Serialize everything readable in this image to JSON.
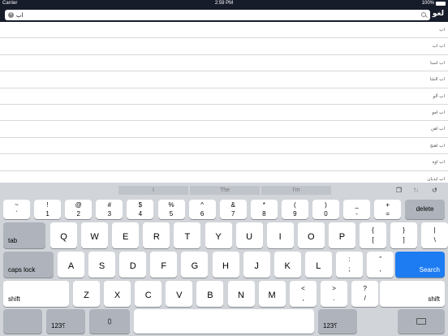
{
  "status_bar": {
    "carrier": "Carrier",
    "time": "2:59 PM",
    "battery": "100%"
  },
  "nav": {
    "title": "لغو",
    "search_value": "اب"
  },
  "results": [
    "اب",
    "اب اب",
    "اب اسبا",
    "اب الشا",
    "اب آلو",
    "اب امو",
    "اب اهن",
    "اب اهنج",
    "اب اوه",
    "اب ایدیان"
  ],
  "keyboard": {
    "predictions": [
      "I",
      "The",
      "I'm"
    ],
    "number_row": [
      {
        "top": "~",
        "bottom": "`"
      },
      {
        "top": "!",
        "bottom": "1"
      },
      {
        "top": "@",
        "bottom": "2"
      },
      {
        "top": "#",
        "bottom": "3"
      },
      {
        "top": "$",
        "bottom": "4"
      },
      {
        "top": "%",
        "bottom": "5"
      },
      {
        "top": "^",
        "bottom": "6"
      },
      {
        "top": "&",
        "bottom": "7"
      },
      {
        "top": "*",
        "bottom": "8"
      },
      {
        "top": "(",
        "bottom": "9"
      },
      {
        "top": ")",
        "bottom": "0"
      },
      {
        "top": "_",
        "bottom": "-"
      },
      {
        "top": "+",
        "bottom": "="
      }
    ],
    "delete_label": "delete",
    "tab_label": "tab",
    "row_q": [
      "Q",
      "W",
      "E",
      "R",
      "T",
      "Y",
      "U",
      "I",
      "O",
      "P"
    ],
    "row_q_extra": [
      {
        "top": "{",
        "bottom": "["
      },
      {
        "top": "}",
        "bottom": "]"
      },
      {
        "top": "|",
        "bottom": "\\"
      }
    ],
    "caps_label": "caps lock",
    "row_a": [
      "A",
      "S",
      "D",
      "F",
      "G",
      "H",
      "J",
      "K",
      "L"
    ],
    "row_a_extra": [
      {
        "top": ":",
        "bottom": ";"
      },
      {
        "top": "”",
        "bottom": ","
      }
    ],
    "search_label": "Search",
    "shift_label": "shift",
    "row_z": [
      "Z",
      "X",
      "C",
      "V",
      "B",
      "N",
      "M"
    ],
    "row_z_extra": [
      {
        "top": "<",
        "bottom": ","
      },
      {
        "top": ">",
        "bottom": "."
      },
      {
        "top": "?",
        "bottom": "/"
      }
    ],
    "num_label": "123؟"
  }
}
